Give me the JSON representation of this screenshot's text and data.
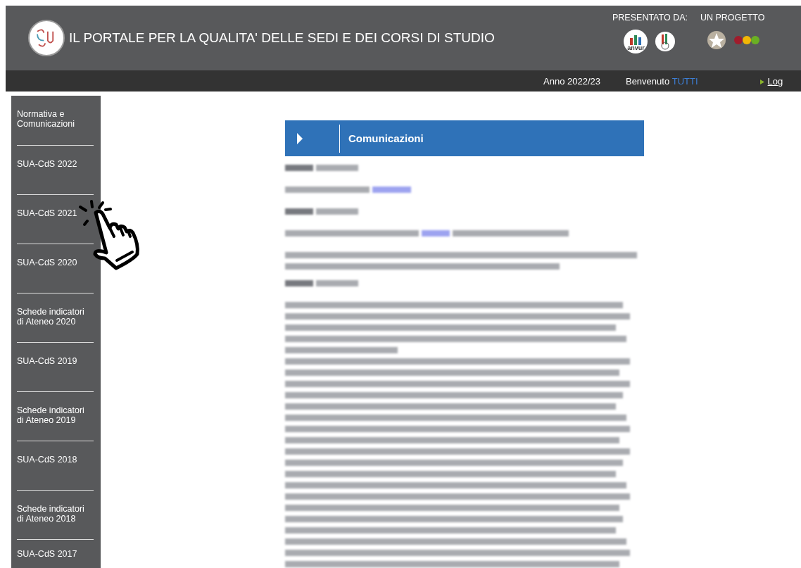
{
  "header": {
    "title": "IL PORTALE PER LA QUALITA' DELLE SEDI E DEI CORSI DI STUDIO",
    "presented_label": "PRESENTATO DA:",
    "presenter_logo_text": "anvur",
    "project_label": "UN PROGETTO"
  },
  "subbar": {
    "year": "Anno 2022/23",
    "welcome": "Benvenuto",
    "user": "TUTTI",
    "login": "Log"
  },
  "sidebar": {
    "items": [
      {
        "label": "Normativa e Comunicazioni",
        "selected": false
      },
      {
        "label": "SUA-CdS 2022",
        "selected": false
      },
      {
        "label": "SUA-CdS 2021",
        "selected": false
      },
      {
        "label": "SUA-CdS 2020",
        "selected": false
      },
      {
        "label": "Schede indicatori di Ateneo 2020",
        "selected": false
      },
      {
        "label": "SUA-CdS 2019",
        "selected": false
      },
      {
        "label": "Schede indicatori di Ateneo 2019",
        "selected": false
      },
      {
        "label": "SUA-CdS 2018",
        "selected": false
      },
      {
        "label": "Schede indicatori di Ateneo 2018",
        "selected": false
      },
      {
        "label": "SUA-CdS 2017",
        "selected": false
      }
    ]
  },
  "panel": {
    "title": "Comunicazioni"
  }
}
